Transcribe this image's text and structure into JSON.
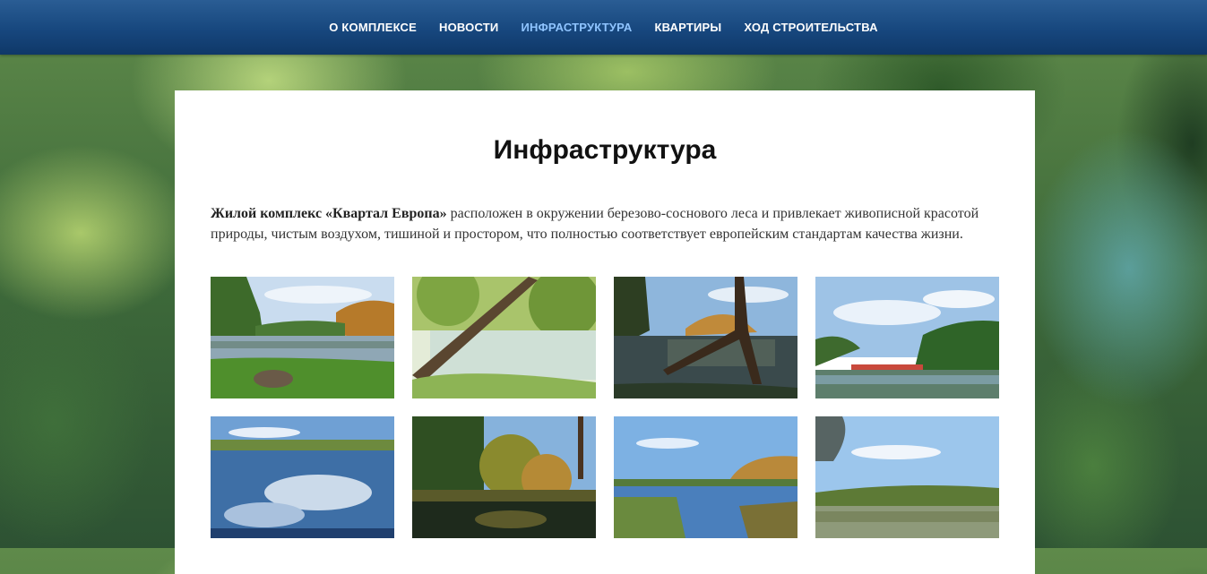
{
  "nav": {
    "items": [
      {
        "label": "О КОМПЛЕКСЕ",
        "active": false
      },
      {
        "label": "НОВОСТИ",
        "active": false
      },
      {
        "label": "ИНФРАСТРУКТУРА",
        "active": true
      },
      {
        "label": "КВАРТИРЫ",
        "active": false
      },
      {
        "label": "ХОД СТРОИТЕЛЬСТВА",
        "active": false
      }
    ]
  },
  "main": {
    "title": "Инфраструктура",
    "intro_bold": "Жилой комплекс «Квартал Европа»",
    "intro_text": " расположен в окружении березово-соснового леса и привлекает живописной красотой природы, чистым воздухом, тишиной и простором, что полностью соответствует европейским стандартам качества жизни."
  },
  "gallery": {
    "photos": [
      {
        "name": "lake-with-grassy-shore-photo"
      },
      {
        "name": "leaning-tree-over-water-photo"
      },
      {
        "name": "fallen-tree-in-lake-photo"
      },
      {
        "name": "lake-with-boat-photo"
      },
      {
        "name": "lake-cloud-reflection-photo"
      },
      {
        "name": "autumn-trees-pond-photo"
      },
      {
        "name": "lake-with-reeds-photo"
      },
      {
        "name": "wide-lake-view-photo"
      }
    ]
  }
}
